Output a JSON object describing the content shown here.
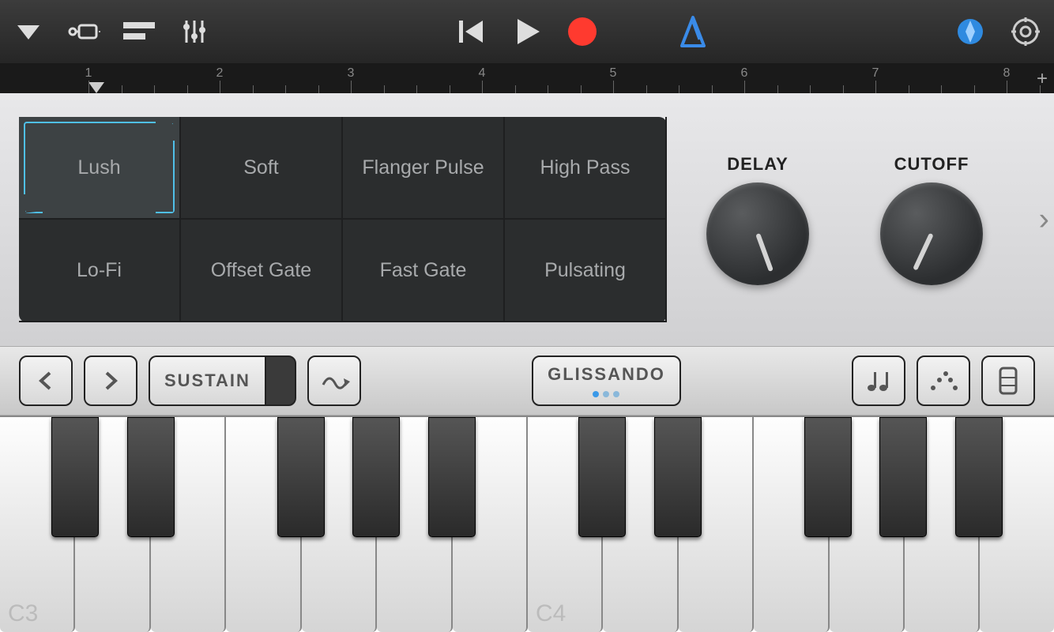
{
  "toolbar": {
    "menu": "menu",
    "browser": "browser",
    "tracks": "tracks",
    "mixer": "mixer",
    "rewind": "rewind",
    "play": "play",
    "record": "record",
    "metronome": "metronome",
    "learn": "learn",
    "settings": "settings"
  },
  "timeline": {
    "bars": [
      "1",
      "2",
      "3",
      "4",
      "5",
      "6",
      "7",
      "8"
    ],
    "add": "+"
  },
  "presets": [
    "Lush",
    "Soft",
    "Flanger Pulse",
    "High Pass",
    "Lo-Fi",
    "Offset Gate",
    "Fast Gate",
    "Pulsating"
  ],
  "selected_preset_index": 0,
  "knobs": {
    "delay_label": "DELAY",
    "cutoff_label": "CUTOFF"
  },
  "panel_next": "›",
  "controls": {
    "octave_prev": "‹",
    "octave_next": "›",
    "sustain_label": "SUSTAIN",
    "glissando_label": "GLISSANDO"
  },
  "keyboard": {
    "labels": {
      "c3": "C3",
      "c4": "C4"
    }
  }
}
